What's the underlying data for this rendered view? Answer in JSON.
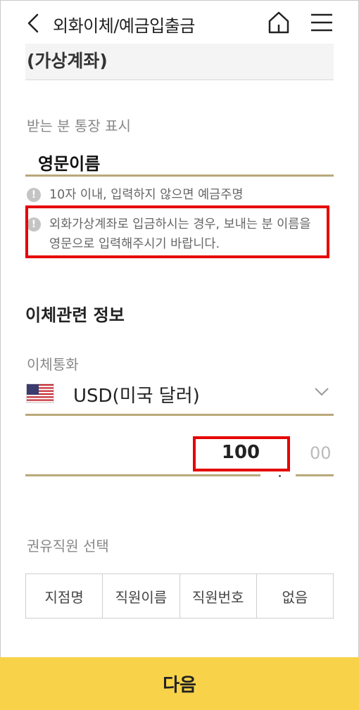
{
  "header": {
    "title": "외화이체/예금입출금"
  },
  "previous_field": {
    "value": "(가상계좌)"
  },
  "recipient_display": {
    "label": "받는 분 통장 표시",
    "value": "영문이름",
    "notice_1": "10자 이내, 입력하지 않으면 예금주명",
    "notice_2_line1": "외화가상계좌로 입금하시는 경우, 보내는 분 이름을",
    "notice_2_line2": "영문으로 입력해주시기 바랍니다."
  },
  "transfer_info": {
    "title": "이체관련 정보",
    "currency_label": "이체통화",
    "currency_value": "USD(미국 달러)",
    "amount_integer": "100",
    "amount_decimal": "00"
  },
  "staff": {
    "label": "권유직원 선택",
    "options": [
      "지점명",
      "직원이름",
      "직원번호",
      "없음"
    ]
  },
  "footer": {
    "next_label": "다음"
  },
  "colors": {
    "accent_gold": "#b9a87a",
    "button_yellow": "#f8d34a",
    "highlight_red": "#e60000"
  }
}
